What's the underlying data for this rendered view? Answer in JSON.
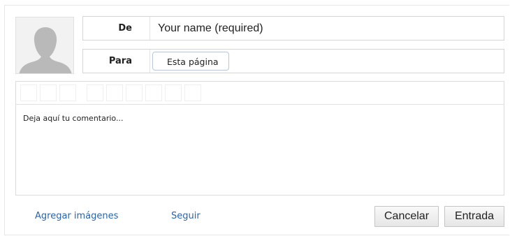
{
  "form": {
    "from_label": "De",
    "name_placeholder": "Your name (required)",
    "to_label": "Para",
    "recipient": "Esta página",
    "comment_placeholder": "Deja aquí tu comentario...",
    "add_images_label": "Agregar imágenes",
    "follow_label": "Seguir",
    "cancel_label": "Cancelar",
    "submit_label": "Entrada"
  },
  "colors": {
    "link": "#2a64a6",
    "border": "#d5d5d5",
    "avatar_bg": "#f2f2f2",
    "avatar_silhouette": "#b9b9b9"
  },
  "toolbar": {
    "group_1_buttons": 3,
    "group_2_buttons": 6
  },
  "icons": {
    "avatar": "user-silhouette-icon"
  }
}
